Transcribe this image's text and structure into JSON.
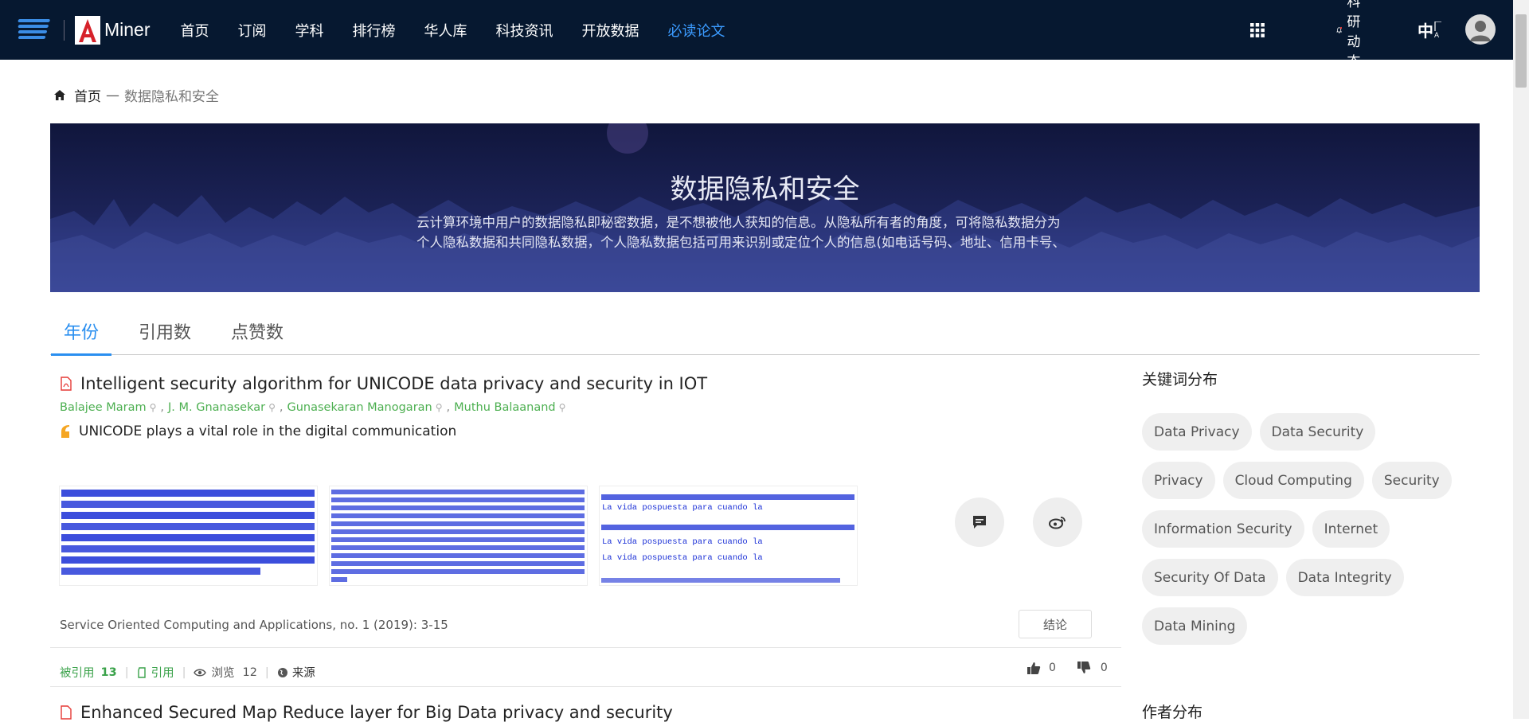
{
  "header": {
    "brand": "Miner",
    "nav": [
      {
        "label": "首页",
        "active": false
      },
      {
        "label": "订阅",
        "active": false
      },
      {
        "label": "学科",
        "active": false
      },
      {
        "label": "排行榜",
        "active": false
      },
      {
        "label": "华人库",
        "active": false
      },
      {
        "label": "科技资讯",
        "active": false
      },
      {
        "label": "开放数据",
        "active": false
      },
      {
        "label": "必读论文",
        "active": true
      }
    ],
    "research_news": "科研动态",
    "language": "中"
  },
  "breadcrumb": {
    "home": "首页",
    "separator": "—",
    "current": "数据隐私和安全"
  },
  "banner": {
    "title": "数据隐私和安全",
    "desc_line1": "云计算环境中用户的数据隐私即秘密数据，是不想被他人获知的信息。从隐私所有者的角度，可将隐私数据分为",
    "desc_line2": "个人隐私数据和共同隐私数据，个人隐私数据包括可用来识别或定位个人的信息(如电话号码、地址、信用卡号、"
  },
  "tabs": [
    {
      "label": "年份",
      "active": true
    },
    {
      "label": "引用数",
      "active": false
    },
    {
      "label": "点赞数",
      "active": false
    }
  ],
  "paper": {
    "title": "Intelligent security algorithm for UNICODE data privacy and security in IOT",
    "authors": [
      "Balajee Maram",
      "J. M. Gnanasekar",
      "Gunasekaran Manogaran",
      "Muthu Balaanand"
    ],
    "summary": "UNICODE plays a vital role in the digital communication",
    "figure_text": "La vida pospuesta para cuando la",
    "venue": "Service Oriented Computing and Applications, no. 1 (2019): 3-15",
    "conclusion_label": "结论",
    "cited_label": "被引用",
    "cited_count": "13",
    "cite_label": "引用",
    "views_label": "浏览",
    "views_count": "12",
    "source_label": "来源",
    "likes": "0",
    "dislikes": "0"
  },
  "paper2": {
    "title": "Enhanced Secured Map Reduce layer for Big Data privacy and security"
  },
  "sidebar": {
    "keywords_heading": "关键词分布",
    "keywords": [
      "Data Privacy",
      "Data Security",
      "Privacy",
      "Cloud Computing",
      "Security",
      "Information Security",
      "Internet",
      "Security Of Data",
      "Data Integrity",
      "Data Mining"
    ],
    "authors_heading": "作者分布"
  },
  "colors": {
    "topbar": "#061830",
    "accent": "#2a8ff0",
    "author_green": "#4caf50",
    "stat_green": "#3aa24a"
  }
}
